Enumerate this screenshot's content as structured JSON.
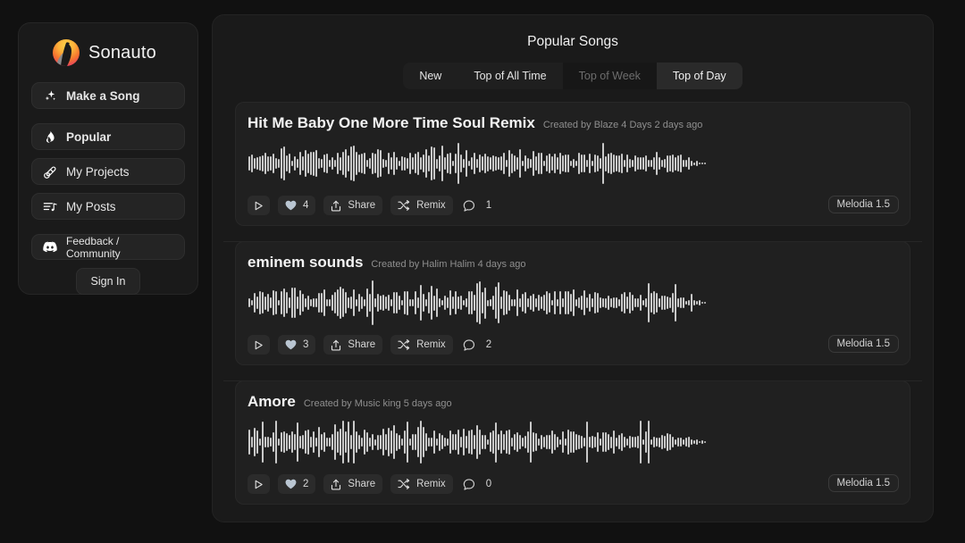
{
  "sidebar": {
    "brand": {
      "name": "Sonauto",
      "logo_icon": "sonauto-bird-logo"
    },
    "primary_action": {
      "label": "Make a Song",
      "icon": "sparkles-icon"
    },
    "items": [
      {
        "label": "Popular",
        "icon": "flame-icon",
        "active": true
      },
      {
        "label": "My Projects",
        "icon": "microphone-icon",
        "active": false
      },
      {
        "label": "My Posts",
        "icon": "list-music-icon",
        "active": false
      }
    ],
    "community": {
      "label": "Feedback / Community",
      "icon": "discord-icon"
    },
    "sign_in": {
      "label": "Sign In"
    }
  },
  "main": {
    "title": "Popular Songs",
    "tabs": [
      {
        "label": "New",
        "state": "normal"
      },
      {
        "label": "Top of All Time",
        "state": "normal"
      },
      {
        "label": "Top of Week",
        "state": "dim"
      },
      {
        "label": "Top of Day",
        "state": "selected"
      }
    ],
    "songs": [
      {
        "title": "Hit Me Baby One More Time Soul Remix",
        "meta": "Created by Blaze 4 Days 2 days ago",
        "play_label": "",
        "likes": "4",
        "share_label": "Share",
        "remix_label": "Remix",
        "comments": "1",
        "model": "Melodia 1.5"
      },
      {
        "title": "eminem sounds",
        "meta": "Created by Halim Halim 4 days ago",
        "play_label": "",
        "likes": "3",
        "share_label": "Share",
        "remix_label": "Remix",
        "comments": "2",
        "model": "Melodia 1.5"
      },
      {
        "title": "Amore",
        "meta": "Created by Music king 5 days ago",
        "play_label": "",
        "likes": "2",
        "share_label": "Share",
        "remix_label": "Remix",
        "comments": "0",
        "model": "Melodia 1.5"
      }
    ]
  },
  "colors": {
    "app_background": "#111111",
    "panel_background": "#1a1a1a",
    "card_background": "#202020",
    "heart_color": "#b9c5d1",
    "waveform_color": "#c9c9c9",
    "text_primary": "#f2f2f2",
    "text_muted": "#8f8f8f",
    "logo_gradient_top": "#ffd24a",
    "logo_gradient_bottom": "#d93a6a"
  }
}
